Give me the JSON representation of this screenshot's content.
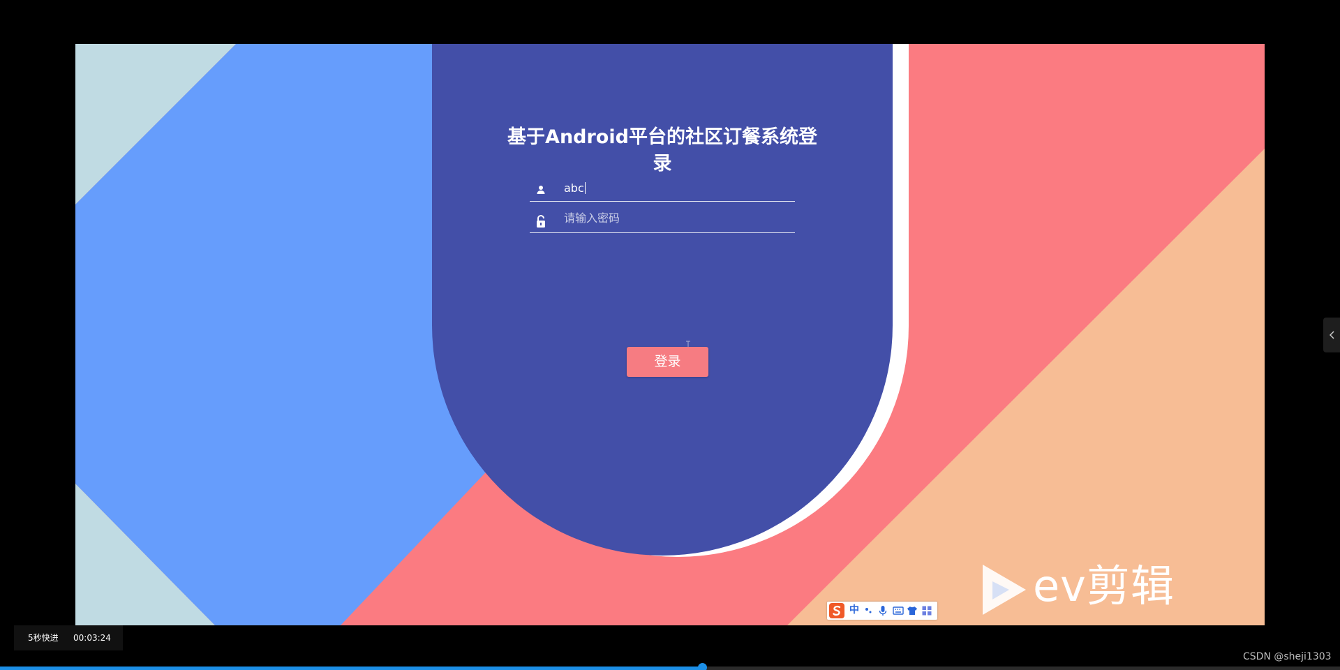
{
  "login_page": {
    "title": "基于Android平台的社区订餐系统登录",
    "username": {
      "icon": "user-icon",
      "value": "abc"
    },
    "password": {
      "icon": "lock-icon",
      "placeholder": "请输入密码"
    },
    "login_button_label": "登录"
  },
  "watermark": {
    "icon": "play-icon",
    "text": "ev剪辑"
  },
  "ime_toolbar": {
    "logo": "sogou-logo-icon",
    "mode_label": "中",
    "icons": [
      "punctuation-icon",
      "microphone-icon",
      "keyboard-icon",
      "skin-icon",
      "toolbox-icon"
    ]
  },
  "player": {
    "skip_label": "5秒快进",
    "current_time": "00:03:24",
    "progress": 0.524,
    "side_panel_icon": "chevron-left-icon"
  },
  "credit": "CSDN @sheji1303",
  "colors": {
    "card": "#434fa8",
    "button": "#f67c82",
    "blue_panel": "#669dfc",
    "coral": "#fb7b81",
    "peach": "#f7bd95",
    "light_blue": "#c0dbe3"
  }
}
